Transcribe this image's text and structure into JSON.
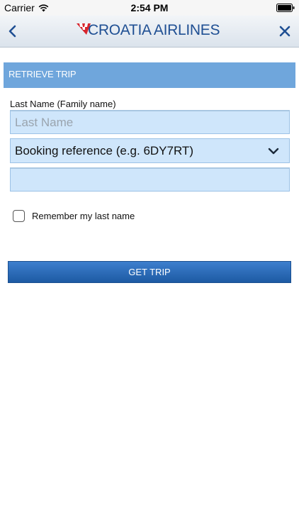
{
  "status_bar": {
    "carrier": "Carrier",
    "time": "2:54 PM"
  },
  "nav": {
    "brand": "CROATIA AIRLINES",
    "back_icon": "chevron-left-icon",
    "close_icon": "close-icon",
    "brand_color": "#1f4f93",
    "logo_accent_color": "#d7262e"
  },
  "section": {
    "title": "RETRIEVE TRIP",
    "color": "#6fa6dc"
  },
  "form": {
    "last_name_label": "Last Name (Family name)",
    "last_name_placeholder": "Last Name",
    "last_name_value": "",
    "booking_select_value": "Booking reference (e.g. 6DY7RT)",
    "booking_reference_value": "",
    "remember_label": "Remember my last name",
    "remember_checked": false,
    "input_bg_color": "#cfe6fb"
  },
  "actions": {
    "get_trip_label": "GET TRIP",
    "button_color": "#2a6bb8"
  }
}
